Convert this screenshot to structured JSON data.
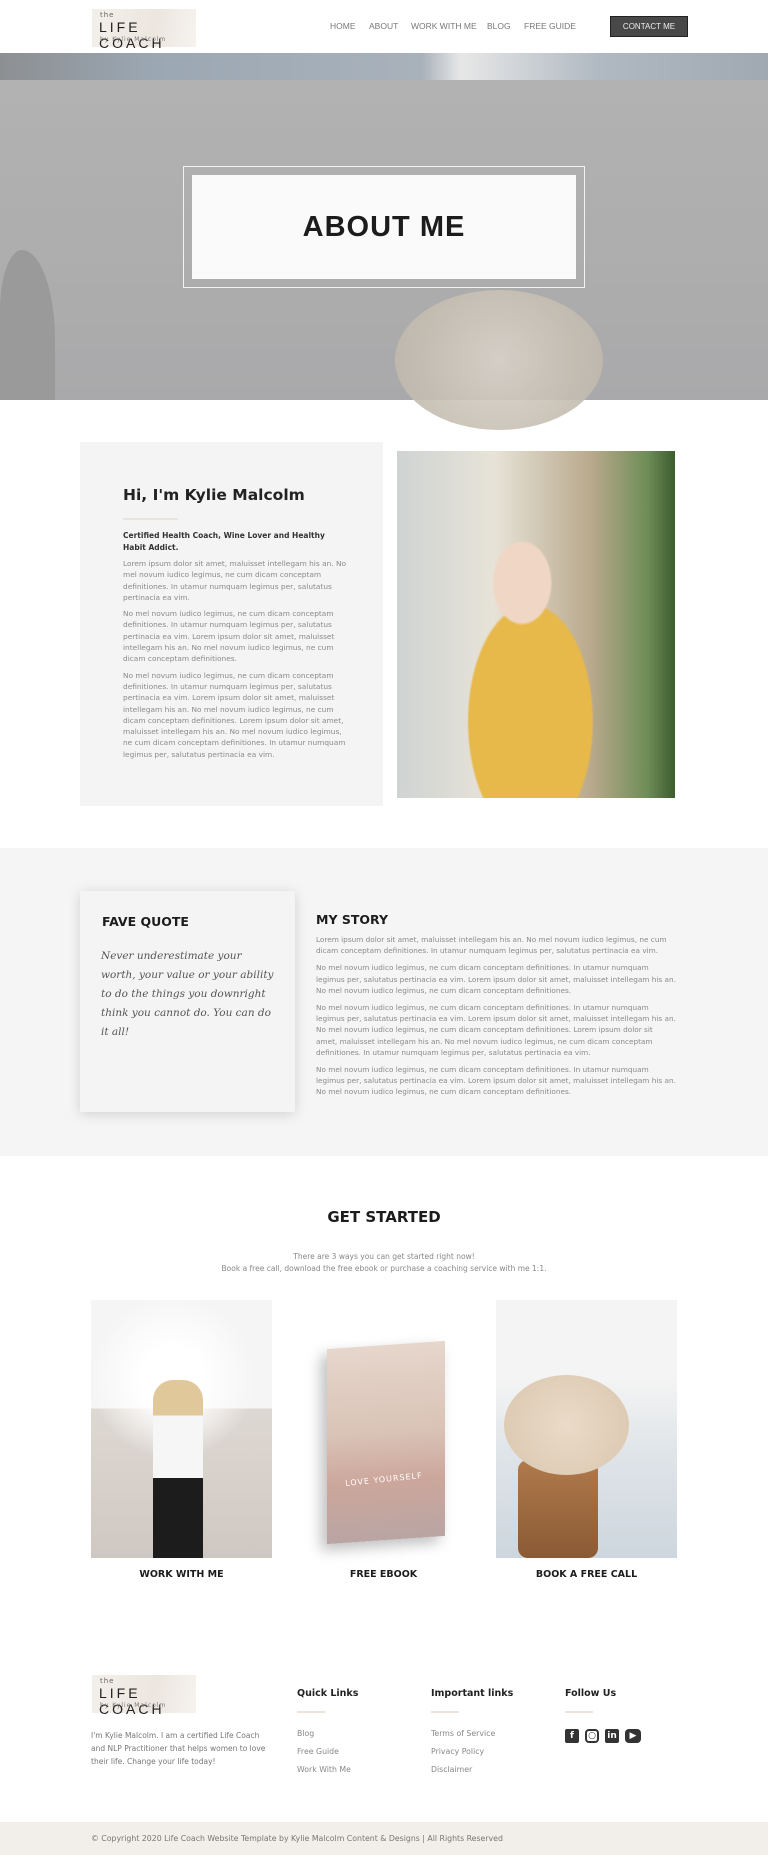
{
  "header": {
    "logo": {
      "the": "the",
      "name": "LIFE COACH",
      "by": "by Kylie Malcolm"
    },
    "nav": [
      "HOME",
      "ABOUT",
      "WORK WITH ME",
      "BLOG",
      "FREE GUIDE"
    ],
    "contact": "CONTACT ME"
  },
  "hero": {
    "title": "ABOUT ME"
  },
  "intro": {
    "heading": "Hi, I'm Kylie Malcolm",
    "subtitle": "Certified Health Coach, Wine Lover and Healthy Habit Addict.",
    "paragraphs": [
      "Lorem ipsum dolor sit amet, maluisset intellegam his an. No mel novum iudico legimus, ne cum dicam conceptam definitiones. In utamur numquam legimus per, salutatus pertinacia ea vim.",
      "No mel novum iudico legimus, ne cum dicam conceptam definitiones. In utamur numquam legimus per, salutatus pertinacia ea vim. Lorem ipsum dolor sit amet, maluisset intellegam his an. No mel novum iudico legimus, ne cum dicam conceptam definitiones.",
      "No mel novum iudico legimus, ne cum dicam conceptam definitiones. In utamur numquam legimus per, salutatus pertinacia ea vim. Lorem ipsum dolor sit amet, maluisset intellegam his an. No mel novum iudico legimus, ne cum dicam conceptam definitiones. Lorem ipsum dolor sit amet, maluisset intellegam his an. No mel novum iudico legimus, ne cum dicam conceptam definitiones. In utamur numquam legimus per, salutatus pertinacia ea vim."
    ]
  },
  "quote": {
    "heading": "FAVE QUOTE",
    "text": "Never underestimate your worth, your value or your ability to do the things you downright think you cannot do. You can do it all!"
  },
  "story": {
    "heading": "MY STORY",
    "paragraphs": [
      "Lorem ipsum dolor sit amet, maluisset intellegam his an. No mel novum iudico legimus, ne cum dicam conceptam definitiones. In utamur numquam legimus per, salutatus pertinacia ea vim.",
      "No mel novum iudico legimus, ne cum dicam conceptam definitiones. In utamur numquam legimus per, salutatus pertinacia ea vim. Lorem ipsum dolor sit amet, maluisset intellegam his an. No mel novum iudico legimus, ne cum dicam conceptam definitiones.",
      "No mel novum iudico legimus, ne cum dicam conceptam definitiones. In utamur numquam legimus per, salutatus pertinacia ea vim. Lorem ipsum dolor sit amet, maluisset intellegam his an. No mel novum iudico legimus, ne cum dicam conceptam definitiones. Lorem ipsum dolor sit amet, maluisset intellegam his an. No mel novum iudico legimus, ne cum dicam conceptam definitiones. In utamur numquam legimus per, salutatus pertinacia ea vim.",
      "No mel novum iudico legimus, ne cum dicam conceptam definitiones. In utamur numquam legimus per, salutatus pertinacia ea vim. Lorem ipsum dolor sit amet, maluisset intellegam his an. No mel novum iudico legimus, ne cum dicam conceptam definitiones."
    ]
  },
  "get_started": {
    "title": "GET STARTED",
    "line1": "There are 3 ways you can get started right now!",
    "line2": "Book a free call, download the free ebook or purchase a coaching service with me 1:1.",
    "cards": [
      "WORK WITH ME",
      "FREE EBOOK",
      "BOOK A FREE CALL"
    ],
    "book_text": "LOVE YOURSELF"
  },
  "footer": {
    "about": "I'm Kylie Malcolm. I am a certified Life Coach and NLP Practitioner that helps women to love their life. Change your life today!",
    "quick_links": {
      "title": "Quick Links",
      "items": [
        "Blog",
        "Free Guide",
        "Work With Me"
      ]
    },
    "important_links": {
      "title": "Important links",
      "items": [
        "Terms of Service",
        "Privacy Policy",
        "Disclaimer"
      ]
    },
    "follow": {
      "title": "Follow Us",
      "icons": [
        "facebook-icon",
        "instagram-icon",
        "linkedin-icon",
        "youtube-icon"
      ]
    },
    "copyright": "© Copyright 2020 Life Coach Website Template by Kylie Malcolm Content & Designs | All Rights Reserved"
  },
  "colors": {
    "button": "#484848",
    "card": "#f4f4f4",
    "footer_bar": "#f2eee9",
    "accent_rule": "#ece4da"
  }
}
